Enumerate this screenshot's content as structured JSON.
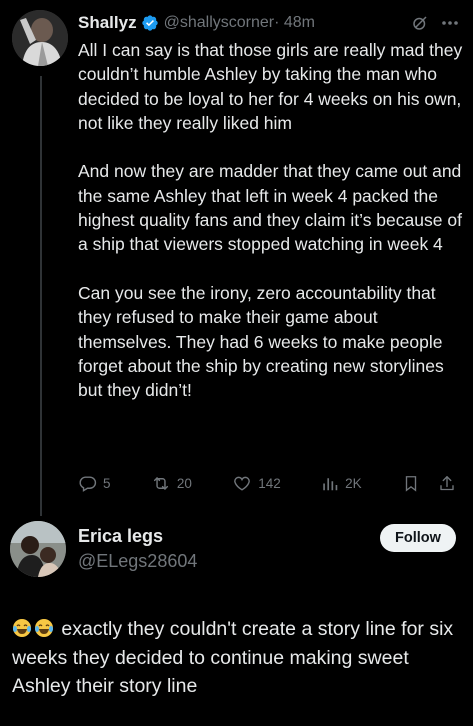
{
  "tweet": {
    "author_name": "Shallyz",
    "author_handle": "@shallyscorner",
    "time": "· 48m",
    "paragraphs": [
      "All I can say is that those girls are really mad they couldn’t humble Ashley by taking the man who decided to be loyal to her for 4 weeks on his own, not like they really liked him",
      "And now they are madder that they came out and the same Ashley that left in week 4 packed the highest quality fans and they claim it’s because of a ship that viewers stopped watching in week 4",
      "Can you see the irony, zero accountability that they refused to make their game about themselves. They had 6 weeks to make people forget about the ship by creating new storylines but they didn’t!"
    ],
    "stats": {
      "replies": "5",
      "reposts": "20",
      "likes": "142",
      "views": "2K"
    }
  },
  "reply": {
    "author_name": "Erica legs",
    "author_handle": "@ELegs28604",
    "follow_label": "Follow",
    "emojis": [
      "laughing-crying",
      "laughing-crying"
    ],
    "text": "exactly they couldn't create a story line for six weeks they decided to continue making sweet Ashley their story line"
  },
  "colors": {
    "background": "#000000",
    "text": "#e7e9ea",
    "muted": "#71767b",
    "verified_badge": "#1d9bf0",
    "follow_button_bg": "#eff3f4"
  },
  "icons": [
    "verified-badge-icon",
    "grok-icon",
    "more-icon",
    "reply-icon",
    "repost-icon",
    "like-icon",
    "views-icon",
    "bookmark-icon",
    "share-icon"
  ]
}
